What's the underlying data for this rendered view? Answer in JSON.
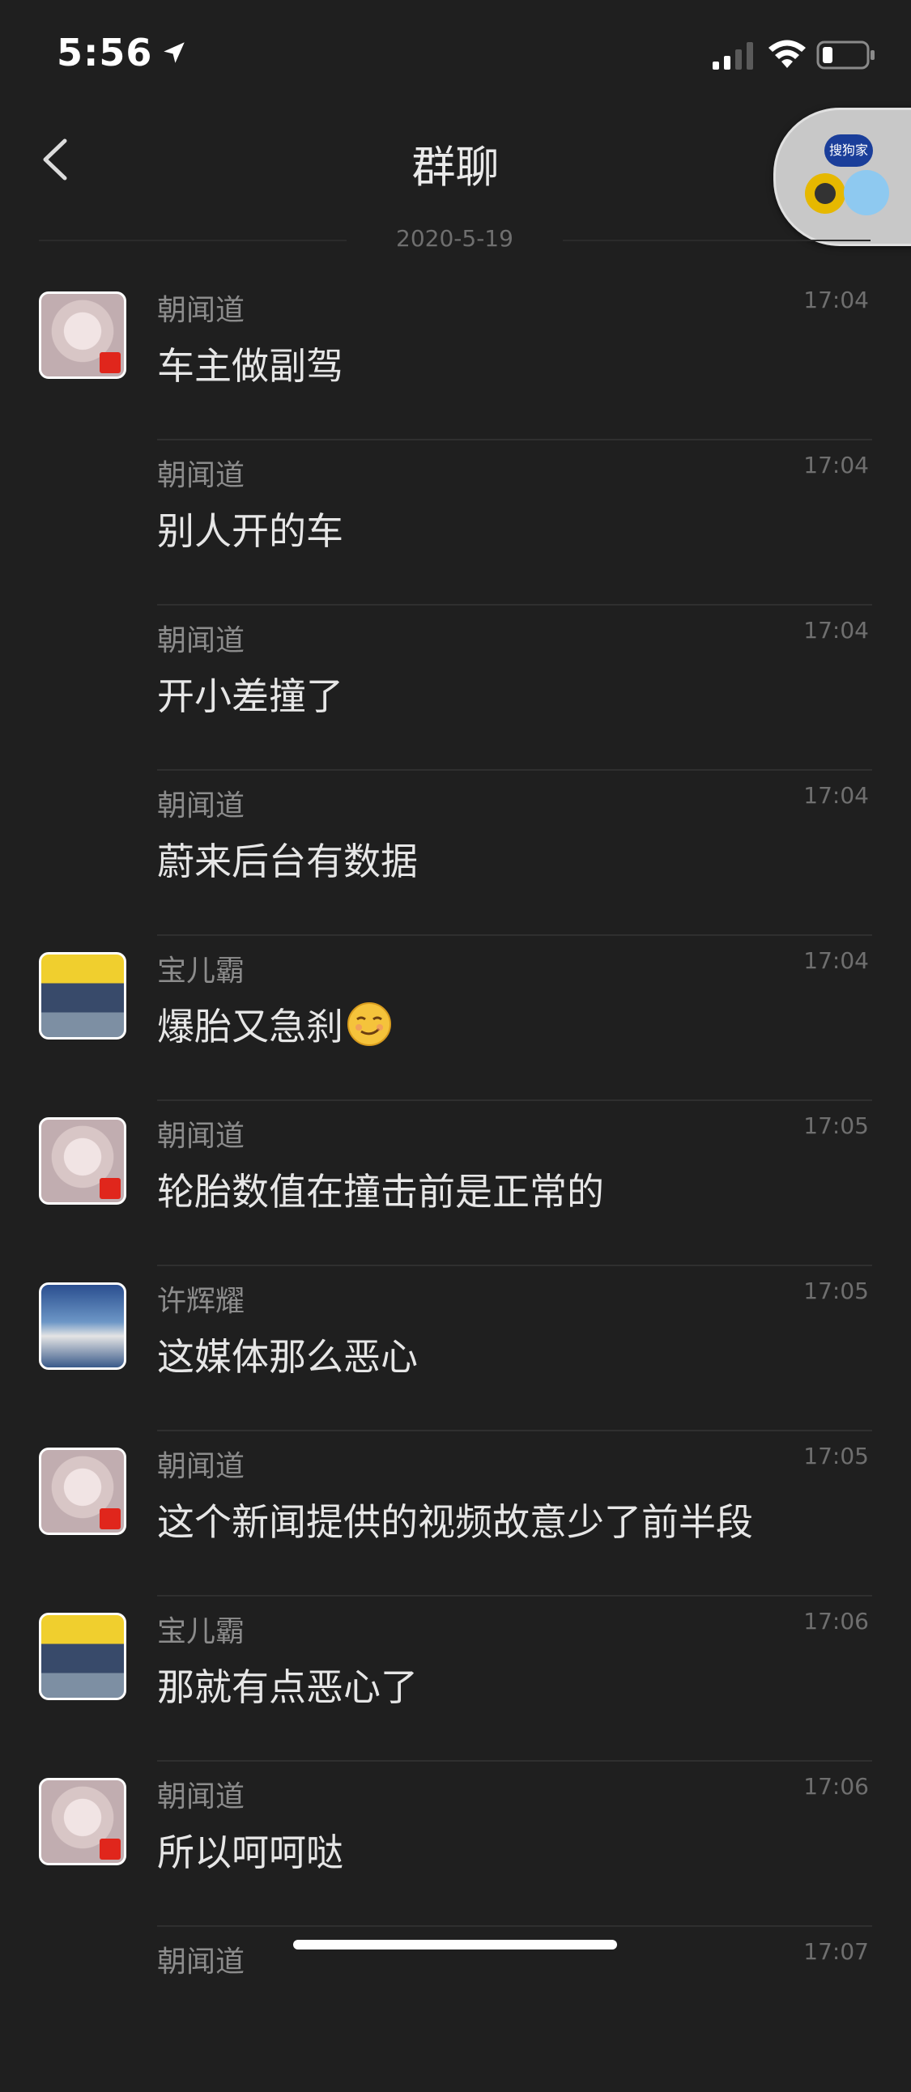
{
  "status_bar": {
    "time": "5:56",
    "icons": [
      "location-arrow-icon",
      "signal-icon",
      "wifi-icon",
      "battery-icon"
    ]
  },
  "nav": {
    "title": "群聊",
    "back_icon": "chevron-left-icon"
  },
  "floating_bubble": {
    "logo_text": "搜狗家"
  },
  "date_separator": "2020-5-19",
  "messages": [
    {
      "sender": "朝闻道",
      "time": "17:04",
      "text": "车主做副驾",
      "avatar": "baby"
    },
    {
      "sender": "朝闻道",
      "time": "17:04",
      "text": "别人开的车",
      "avatar": ""
    },
    {
      "sender": "朝闻道",
      "time": "17:04",
      "text": "开小差撞了",
      "avatar": ""
    },
    {
      "sender": "朝闻道",
      "time": "17:04",
      "text": "蔚来后台有数据",
      "avatar": ""
    },
    {
      "sender": "宝儿霸",
      "time": "17:04",
      "text": "爆胎又急刹",
      "avatar": "kids",
      "emoji": "smirk-emoji"
    },
    {
      "sender": "朝闻道",
      "time": "17:05",
      "text": "轮胎数值在撞击前是正常的",
      "avatar": "baby"
    },
    {
      "sender": "许辉耀",
      "time": "17:05",
      "text": "这媒体那么恶心",
      "avatar": "sky"
    },
    {
      "sender": "朝闻道",
      "time": "17:05",
      "text": "这个新闻提供的视频故意少了前半段",
      "avatar": "baby"
    },
    {
      "sender": "宝儿霸",
      "time": "17:06",
      "text": "那就有点恶心了",
      "avatar": "kids"
    },
    {
      "sender": "朝闻道",
      "time": "17:06",
      "text": "所以呵呵哒",
      "avatar": "baby"
    },
    {
      "sender": "朝闻道",
      "time": "17:07",
      "text": "",
      "avatar": ""
    }
  ],
  "colors": {
    "background": "#1f1f1f",
    "text_primary": "#e6e6e6",
    "text_secondary": "#8c8c8c",
    "divider": "#2f2f2f"
  }
}
